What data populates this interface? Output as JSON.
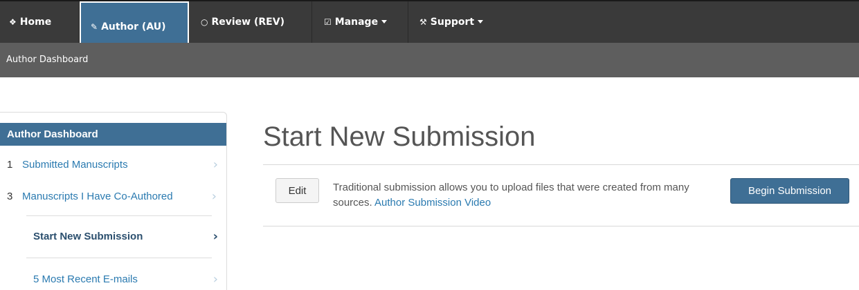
{
  "topnav": {
    "items": [
      {
        "icon": "home-icon",
        "glyph": "❖",
        "label": "Home"
      },
      {
        "icon": "pencil-icon",
        "glyph": "✎",
        "label": "Author (AU)"
      },
      {
        "icon": "speech-bubble-icon",
        "glyph": "○",
        "label": "Review (REV)"
      },
      {
        "icon": "checkbox-icon",
        "glyph": "☑",
        "label": "Manage"
      },
      {
        "icon": "wrench-icon",
        "glyph": "⚒",
        "label": "Support"
      }
    ]
  },
  "subbar": {
    "title": "Author Dashboard"
  },
  "sidebar": {
    "heading": "Author Dashboard",
    "items": [
      {
        "count": "1",
        "label": "Submitted Manuscripts"
      },
      {
        "count": "3",
        "label": "Manuscripts I Have Co-Authored"
      },
      {
        "count": "",
        "label": "Start New Submission"
      },
      {
        "count": "",
        "label": "5 Most Recent E-mails"
      }
    ],
    "chevron": "›"
  },
  "main": {
    "title": "Start New Submission",
    "edit_label": "Edit",
    "description": "Traditional submission allows you to upload files that were created from many sources.",
    "video_link": "Author Submission Video",
    "begin_label": "Begin Submission"
  },
  "colors": {
    "nav_bg": "#3a3a3a",
    "subbar_bg": "#5e5e5e",
    "accent": "#3f6f95",
    "link": "#2a7ab0"
  }
}
